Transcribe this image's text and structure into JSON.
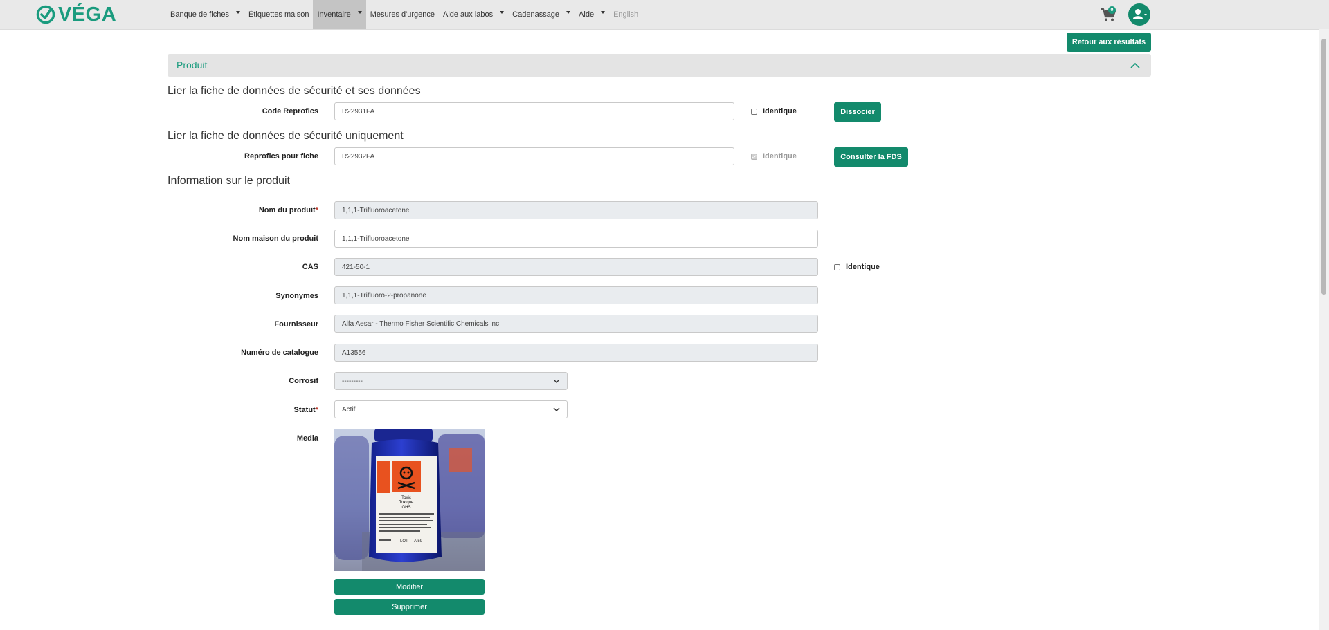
{
  "brand": {
    "name": "VÉGA",
    "color": "#1a9b7e"
  },
  "nav": {
    "items": [
      {
        "label": "Banque de fiches",
        "has_dropdown": true,
        "state": "normal"
      },
      {
        "label": "Étiquettes maison",
        "has_dropdown": false,
        "state": "normal"
      },
      {
        "label": "Inventaire",
        "has_dropdown": true,
        "state": "active"
      },
      {
        "label": "Mesures d'urgence",
        "has_dropdown": false,
        "state": "normal"
      },
      {
        "label": "Aide aux labos",
        "has_dropdown": true,
        "state": "normal"
      },
      {
        "label": "Cadenassage",
        "has_dropdown": true,
        "state": "normal"
      },
      {
        "label": "Aide",
        "has_dropdown": true,
        "state": "normal"
      },
      {
        "label": "English",
        "has_dropdown": false,
        "state": "disabled"
      }
    ],
    "cart_count": "0",
    "cart_icon": "shopping-cart-icon",
    "user_icon": "user-icon"
  },
  "actions": {
    "back_to_results": "Retour aux résultats"
  },
  "panel": {
    "title": "Produit",
    "toggle_icon": "chevron-up-icon"
  },
  "section_sds_data": {
    "title": "Lier la fiche de données de sécurité et ses données",
    "code_label": "Code Reprofics",
    "code_value": "R22931FA",
    "identical_label": "Identique",
    "identical_checked": false,
    "dissociate_button": "Dissocier"
  },
  "section_sds_only": {
    "title": "Lier la fiche de données de sécurité uniquement",
    "code_label": "Reprofics pour fiche",
    "code_value": "R22932FA",
    "identical_label": "Identique",
    "identical_checked": true,
    "consult_button": "Consulter la FDS"
  },
  "product_info": {
    "title": "Information sur le produit",
    "required_marker": "*",
    "fields": {
      "product_name": {
        "label": "Nom du produit",
        "value": "1,1,1-Trifluoroacetone",
        "required": true
      },
      "house_name": {
        "label": "Nom maison du produit",
        "value": "1,1,1-Trifluoroacetone"
      },
      "cas": {
        "label": "CAS",
        "value": "421-50-1",
        "identical_label": "Identique"
      },
      "synonyms": {
        "label": "Synonymes",
        "value": "1,1,1-Trifluoro-2-propanone"
      },
      "supplier": {
        "label": "Fournisseur",
        "value": "Alfa Aesar - Thermo Fisher Scientific Chemicals inc"
      },
      "catalog": {
        "label": "Numéro de catalogue",
        "value": "A13556"
      },
      "corrosive": {
        "label": "Corrosif",
        "value": "---------"
      },
      "status": {
        "label": "Statut",
        "value": "Actif",
        "required": true
      },
      "media": {
        "label": "Media"
      }
    },
    "media_image": {
      "hazard_text": [
        "Toxic",
        "Toxique",
        "GHS"
      ],
      "lot_label": "LOT",
      "lot_value": "A 59"
    },
    "media_buttons": {
      "edit": "Modifier",
      "delete": "Supprimer"
    }
  }
}
